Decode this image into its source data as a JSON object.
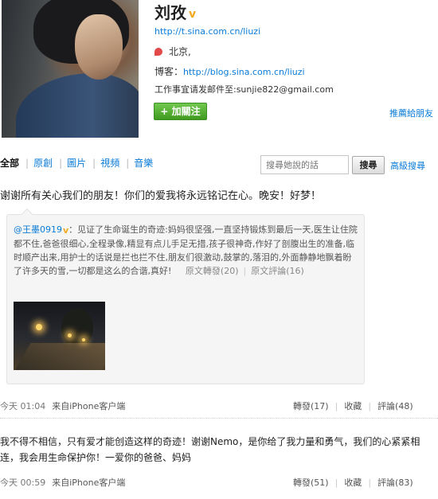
{
  "profile": {
    "name": "刘孜",
    "verified_mark": "v",
    "url": "http://t.sina.com.cn/liuzi",
    "location": "北京,",
    "blog_label": "博客：",
    "blog_url": "http://blog.sina.com.cn/liuzi",
    "email_line": "工作事宜请发邮件至:sunjie822@gmail.com",
    "follow_label": "+ 加關注",
    "recommend_label": "推薦給朋友"
  },
  "filter": {
    "tabs": [
      {
        "label": "全部",
        "active": true
      },
      {
        "label": "原創",
        "active": false
      },
      {
        "label": "圖片",
        "active": false
      },
      {
        "label": "視頻",
        "active": false
      },
      {
        "label": "音樂",
        "active": false
      }
    ],
    "search_placeholder": "搜尋她說的話",
    "search_button": "搜尋",
    "advanced_search": "高級搜尋"
  },
  "posts": [
    {
      "text": "谢谢所有关心我们的朋友！你们的爱我将永远铭记在心。晚安！好梦！",
      "repost": {
        "author": "@王墨0919",
        "verified_mark": "v",
        "text": "：见证了生命诞生的奇迹:妈妈很坚强,一直坚持锻炼到最后一天,医生让住院都不住,爸爸很细心,全程录像,精显有点儿手足无措,孩子很神奇,作好了剖腹出生的准备,临时顺产出来,用护士的话说是拦也拦不住,朋友们很激动,鼓掌的,落泪的,外面静静地飘着盼了许多天的雪,一切都是这么的合谐,真好!",
        "forward_link": "原文轉發(20)",
        "comment_link": "原文評論(16)"
      },
      "time": "今天 01:04",
      "source": "来自iPhone客户端",
      "forward": "轉發(17)",
      "favorite": "收藏",
      "comment": "評論(48)"
    },
    {
      "text": "我不得不相信，只有爱才能创造这样的奇迹！谢谢Nemo，是你给了我力量和勇气，我们的心紧紧相连，我会用生命保护你！一爱你的爸爸、妈妈",
      "time": "今天 00:59",
      "source": "来自iPhone客户端",
      "forward": "轉發(51)",
      "favorite": "收藏",
      "comment": "評論(83)"
    }
  ]
}
